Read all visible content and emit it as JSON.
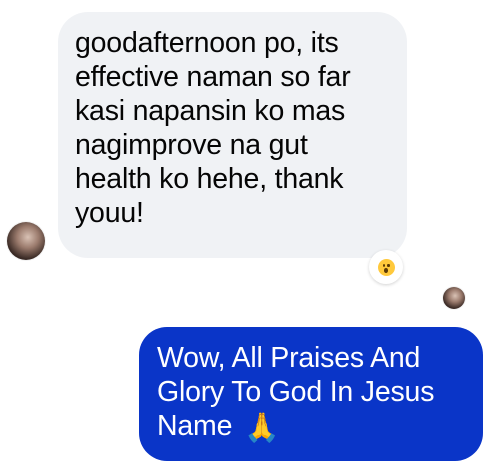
{
  "incoming_message": {
    "lines": [
      "goodafternoon po, its",
      "effective naman so far",
      "kasi napansin ko mas",
      "nagimprove na gut",
      "health ko hehe, thank",
      "youu!"
    ],
    "reaction_icon": "surprised-face-emoji"
  },
  "outgoing_message": {
    "lines": [
      "Wow, All Praises And",
      "Glory To God In Jesus",
      "Name"
    ],
    "trailing_emoji": "🙏"
  },
  "colors": {
    "incoming_bubble": "#f0f2f5",
    "incoming_text": "#050505",
    "outgoing_bubble": "#0a35c8",
    "outgoing_text": "#ffffff"
  }
}
